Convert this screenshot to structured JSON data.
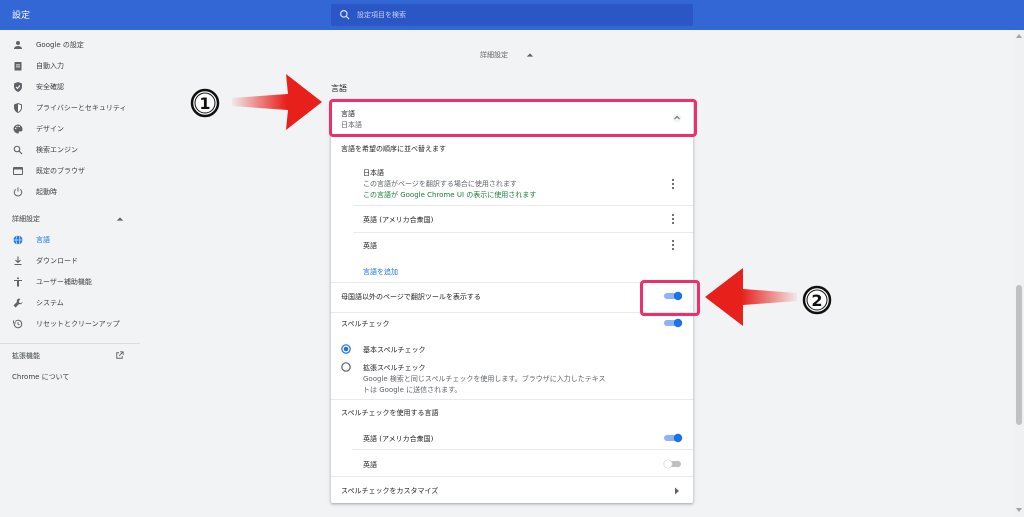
{
  "app": {
    "title": "設定"
  },
  "search": {
    "placeholder": "設定項目を検索"
  },
  "sidebar": {
    "items": [
      {
        "label": "Google の設定"
      },
      {
        "label": "自動入力"
      },
      {
        "label": "安全確認"
      },
      {
        "label": "プライバシーとセキュリティ"
      },
      {
        "label": "デザイン"
      },
      {
        "label": "検索エンジン"
      },
      {
        "label": "既定のブラウザ"
      },
      {
        "label": "起動時"
      }
    ],
    "advanced_label": "詳細設定",
    "advanced_items": [
      {
        "label": "言語"
      },
      {
        "label": "ダウンロード"
      },
      {
        "label": "ユーザー補助機能"
      },
      {
        "label": "システム"
      },
      {
        "label": "リセットとクリーンアップ"
      }
    ],
    "extensions_label": "拡張機能",
    "about_label": "Chrome について"
  },
  "main": {
    "advanced_header": "詳細設定",
    "section_title": "言語",
    "language_row": {
      "title": "言語",
      "value": "日本語"
    },
    "order_label": "言語を希望の順序に並べ替えます",
    "languages": [
      {
        "name": "日本語",
        "desc1": "この言語がページを翻訳する場合に使用されます",
        "desc2": "この言語が Google Chrome UI の表示に使用されます"
      },
      {
        "name": "英語 (アメリカ合衆国)"
      },
      {
        "name": "英語"
      }
    ],
    "add_language": "言語を追加",
    "translate_offer": {
      "label": "母国語以外のページで翻訳ツールを表示する",
      "enabled": true
    },
    "spellcheck": {
      "label": "スペルチェック",
      "enabled": true
    },
    "basic_spell": {
      "label": "基本スペルチェック",
      "selected": true
    },
    "enhanced_spell": {
      "label": "拡張スペルチェック",
      "desc1": "Google 検索と同じスペルチェックを使用します。ブラウザに入力したテキス",
      "desc2": "トは Google に送信されます。",
      "selected": false
    },
    "spell_langs_label": "スペルチェックを使用する言語",
    "spell_langs": [
      {
        "name": "英語 (アメリカ合衆国)",
        "enabled": true
      },
      {
        "name": "英語",
        "enabled": false
      }
    ],
    "customize_spell": "スペルチェックをカスタマイズ"
  },
  "annotations": {
    "badge1": "1",
    "badge2": "2"
  },
  "colors": {
    "accent": "#1a73e8",
    "header": "#3367d6",
    "highlight": "#ed2f6b",
    "arrow": "#e8201c"
  }
}
